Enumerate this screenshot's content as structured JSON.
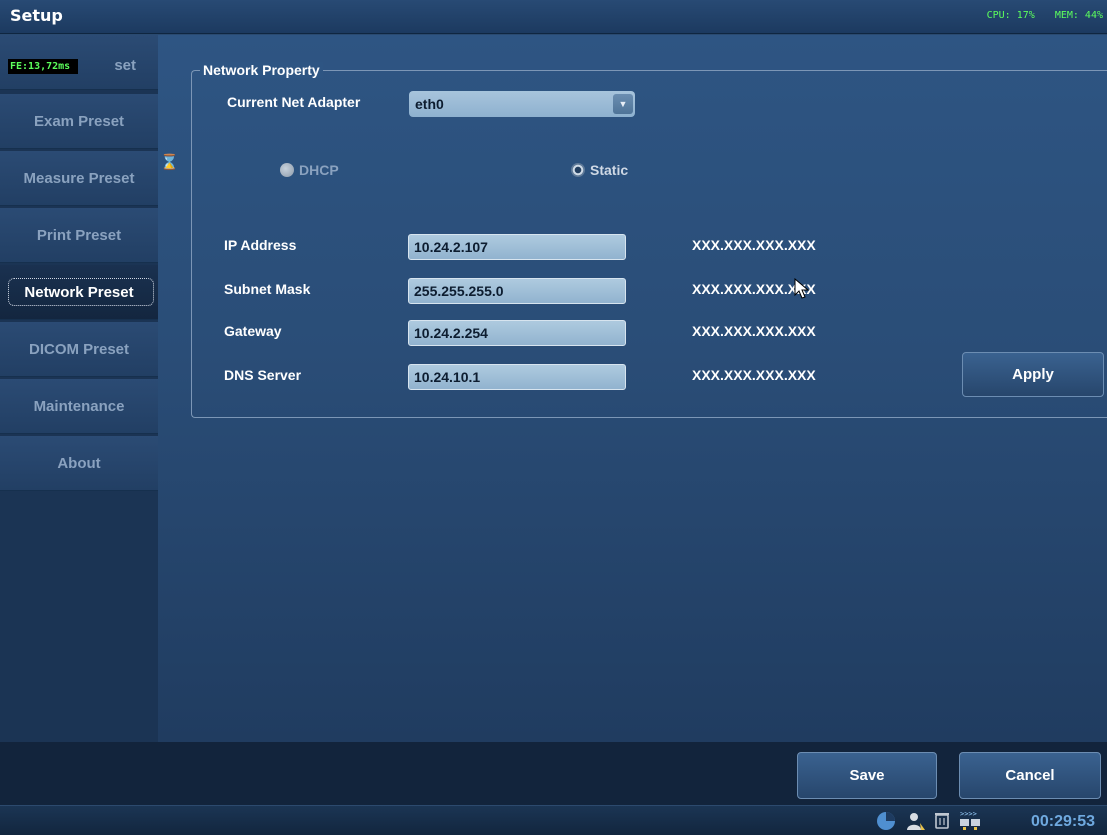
{
  "window": {
    "title": "Setup",
    "cpu": "CPU: 17%",
    "mem": "MEM: 44%"
  },
  "sidebar": {
    "fe_badge": "FE:13,72ms",
    "items": [
      {
        "label": "set"
      },
      {
        "label": "Exam Preset"
      },
      {
        "label": "Measure Preset"
      },
      {
        "label": "Print Preset"
      },
      {
        "label": "Network Preset",
        "active": true
      },
      {
        "label": "DICOM Preset"
      },
      {
        "label": "Maintenance"
      },
      {
        "label": "About"
      }
    ]
  },
  "network": {
    "group_title": "Network Property",
    "adapter_label": "Current Net Adapter",
    "adapter_value": "eth0",
    "dhcp_label": "DHCP",
    "static_label": "Static",
    "mode_selected": "Static",
    "fields": [
      {
        "label": "IP Address",
        "value": "10.24.2.107",
        "format": "XXX.XXX.XXX.XXX"
      },
      {
        "label": "Subnet Mask",
        "value": "255.255.255.0",
        "format": "XXX.XXX.XXX.XXX"
      },
      {
        "label": "Gateway",
        "value": "10.24.2.254",
        "format": "XXX.XXX.XXX.XXX"
      },
      {
        "label": "DNS Server",
        "value": "10.24.10.1",
        "format": "XXX.XXX.XXX.XXX"
      }
    ],
    "apply_label": "Apply"
  },
  "footer": {
    "save_label": "Save",
    "cancel_label": "Cancel"
  },
  "status": {
    "clock": "00:29:53",
    "tray_icons": [
      "disk-usage-icon",
      "user-icon",
      "trash-icon",
      "network-transfer-icon"
    ]
  },
  "colors": {
    "background": "#2a4a70",
    "sidebar_active": "#13263f",
    "status_green": "#5cff5c",
    "clock_blue": "#6fa9df"
  }
}
